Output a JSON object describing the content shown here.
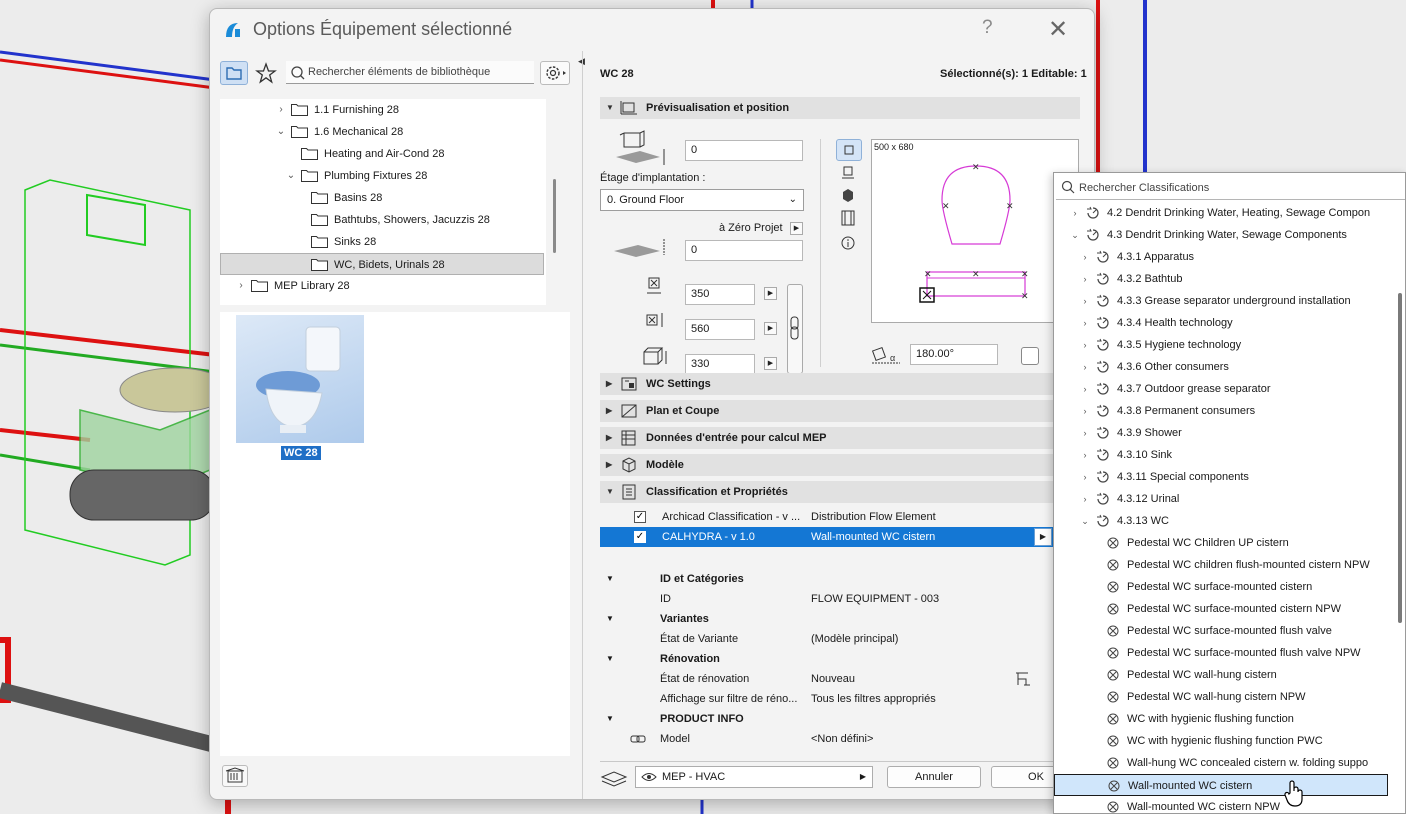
{
  "dialog": {
    "title": "Options Équipement sélectionné",
    "help_glyph": "?",
    "close_glyph": "✕"
  },
  "library": {
    "search_placeholder": "Rechercher éléments de bibliothèque",
    "tree": [
      {
        "label": "1.1 Furnishing 28",
        "expanded": false,
        "level": 1
      },
      {
        "label": "1.6 Mechanical 28",
        "expanded": true,
        "level": 1
      },
      {
        "label": "Heating and Air-Cond 28",
        "level": 2
      },
      {
        "label": "Plumbing Fixtures 28",
        "expanded": true,
        "level": 2
      },
      {
        "label": "Basins 28",
        "level": 3
      },
      {
        "label": "Bathtubs, Showers, Jacuzzis 28",
        "level": 3
      },
      {
        "label": "Sinks 28",
        "level": 3
      },
      {
        "label": "WC, Bidets, Urinals 28",
        "level": 3,
        "selected": true
      },
      {
        "label": "MEP Library 28",
        "expanded": false,
        "level": 0
      }
    ],
    "selected_item": "WC 28"
  },
  "header": {
    "element_name": "WC 28",
    "selection_info": "Sélectionné(s): 1 Editable: 1"
  },
  "preview_position": {
    "section_title": "Prévisualisation et position",
    "elevation_value": "0",
    "story_label": "Étage d'implantation :",
    "story_value": "0. Ground Floor",
    "reference_label": "à Zéro Projet",
    "reference_value": "0",
    "width": "350",
    "depth": "560",
    "height": "330",
    "preview_size": "500 x 680",
    "rotation": "180.00°"
  },
  "sections": [
    {
      "title": "WC Settings"
    },
    {
      "title": "Plan et Coupe"
    },
    {
      "title": "Données d'entrée pour calcul MEP"
    },
    {
      "title": "Modèle"
    },
    {
      "title": "Classification et Propriétés"
    }
  ],
  "classifications": [
    {
      "system": "Archicad Classification - v ...",
      "value": "Distribution Flow Element",
      "checked": true,
      "selected": false
    },
    {
      "system": "CALHYDRA - v 1.0",
      "value": "Wall-mounted WC cistern",
      "checked": true,
      "selected": true
    }
  ],
  "properties": [
    {
      "type": "group",
      "key": "ID et Catégories"
    },
    {
      "type": "item",
      "key": "ID",
      "value": "FLOW EQUIPMENT - 003"
    },
    {
      "type": "group",
      "key": "Variantes"
    },
    {
      "type": "item",
      "key": "État de Variante",
      "value": "(Modèle principal)"
    },
    {
      "type": "group",
      "key": "Rénovation"
    },
    {
      "type": "item",
      "key": "État de rénovation",
      "value": "Nouveau"
    },
    {
      "type": "item",
      "key": "Affichage sur filtre de réno...",
      "value": "Tous les filtres appropriés"
    },
    {
      "type": "group",
      "key": "PRODUCT INFO"
    },
    {
      "type": "item",
      "key": "Model",
      "value": "<Non défini>"
    }
  ],
  "footer": {
    "layer": "MEP - HVAC",
    "cancel": "Annuler",
    "ok": "OK"
  },
  "classification_popup": {
    "search_placeholder": "Rechercher Classifications",
    "items": [
      {
        "label": "4.2 Dendrit Drinking Water, Heating, Sewage Compon",
        "level": 0,
        "chev": "›"
      },
      {
        "label": "4.3 Dendrit Drinking Water, Sewage Components",
        "level": 0,
        "chev": "⌄"
      },
      {
        "label": "4.3.1 Apparatus",
        "level": 1,
        "chev": "›"
      },
      {
        "label": "4.3.2 Bathtub",
        "level": 1,
        "chev": "›"
      },
      {
        "label": "4.3.3 Grease separator underground installation",
        "level": 1,
        "chev": "›"
      },
      {
        "label": "4.3.4 Health technology",
        "level": 1,
        "chev": "›"
      },
      {
        "label": "4.3.5 Hygiene technology",
        "level": 1,
        "chev": "›"
      },
      {
        "label": "4.3.6 Other consumers",
        "level": 1,
        "chev": "›"
      },
      {
        "label": "4.3.7 Outdoor grease separator",
        "level": 1,
        "chev": "›"
      },
      {
        "label": "4.3.8 Permanent consumers",
        "level": 1,
        "chev": "›"
      },
      {
        "label": "4.3.9 Shower",
        "level": 1,
        "chev": "›"
      },
      {
        "label": "4.3.10 Sink",
        "level": 1,
        "chev": "›"
      },
      {
        "label": "4.3.11 Special components",
        "level": 1,
        "chev": "›"
      },
      {
        "label": "4.3.12 Urinal",
        "level": 1,
        "chev": "›"
      },
      {
        "label": "4.3.13 WC",
        "level": 1,
        "chev": "⌄"
      },
      {
        "label": "Pedestal WC Children UP cistern",
        "level": 2
      },
      {
        "label": "Pedestal WC children flush-mounted cistern NPW",
        "level": 2
      },
      {
        "label": "Pedestal WC surface-mounted cistern",
        "level": 2
      },
      {
        "label": "Pedestal WC surface-mounted cistern NPW",
        "level": 2
      },
      {
        "label": "Pedestal WC surface-mounted flush valve",
        "level": 2
      },
      {
        "label": "Pedestal WC surface-mounted flush valve NPW",
        "level": 2
      },
      {
        "label": "Pedestal WC wall-hung cistern",
        "level": 2
      },
      {
        "label": "Pedestal WC wall-hung cistern NPW",
        "level": 2
      },
      {
        "label": "WC with hygienic flushing function",
        "level": 2
      },
      {
        "label": "WC with hygienic flushing function PWC",
        "level": 2
      },
      {
        "label": "Wall-hung WC concealed cistern w. folding suppo",
        "level": 2
      },
      {
        "label": "Wall-mounted WC cistern",
        "level": 2,
        "selected": true
      },
      {
        "label": "Wall-mounted WC cistern NPW",
        "level": 2
      }
    ]
  },
  "colors": {
    "accent": "#1477d4",
    "wireframe": "#22bb22",
    "pipe_red": "#dd1111"
  }
}
